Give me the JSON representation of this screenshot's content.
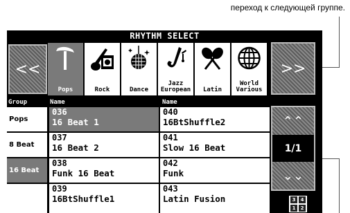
{
  "caption": "переход к следующей группе.",
  "screen": {
    "title": "RHYTHM SELECT",
    "prev_button": "<<",
    "next_button": ">>",
    "categories": [
      {
        "label": "Pops",
        "icon": "microphone-icon",
        "selected": true
      },
      {
        "label": "Rock",
        "icon": "guitar-amp-icon",
        "selected": false
      },
      {
        "label": "Dance",
        "icon": "disco-ball-icon",
        "selected": false
      },
      {
        "label": "Jazz\nEuropean",
        "icon": "saxophone-icon",
        "selected": false
      },
      {
        "label": "Latin",
        "icon": "maracas-icon",
        "selected": false
      },
      {
        "label": "World\nVarious",
        "icon": "globe-icon",
        "selected": false
      }
    ],
    "headers": {
      "group": "Group",
      "name1": "Name",
      "name2": "Name"
    },
    "groups": [
      "Pops",
      "8 Beat",
      "16 Beat",
      ""
    ],
    "rhythms": [
      {
        "num": "036",
        "name": "16 Beat 1",
        "selected": true
      },
      {
        "num": "040",
        "name": "16BtShuffle2",
        "selected": false
      },
      {
        "num": "037",
        "name": "16 Beat 2",
        "selected": false
      },
      {
        "num": "041",
        "name": "Slow 16 Beat",
        "selected": false
      },
      {
        "num": "038",
        "name": "Funk 16 Beat",
        "selected": false
      },
      {
        "num": "042",
        "name": "Funk",
        "selected": false
      },
      {
        "num": "039",
        "name": "16BtShuffle1",
        "selected": false
      },
      {
        "num": "043",
        "name": "Latin Fusion",
        "selected": false
      }
    ],
    "scroll": {
      "up": "⌃⌃",
      "page": "1/1",
      "down": "⌄⌄"
    },
    "keypad": [
      "3",
      "4",
      "1",
      "2"
    ],
    "colors": {
      "selected": "#7a7a7a",
      "background": "#000000",
      "frame": "#bdbdbd"
    }
  }
}
